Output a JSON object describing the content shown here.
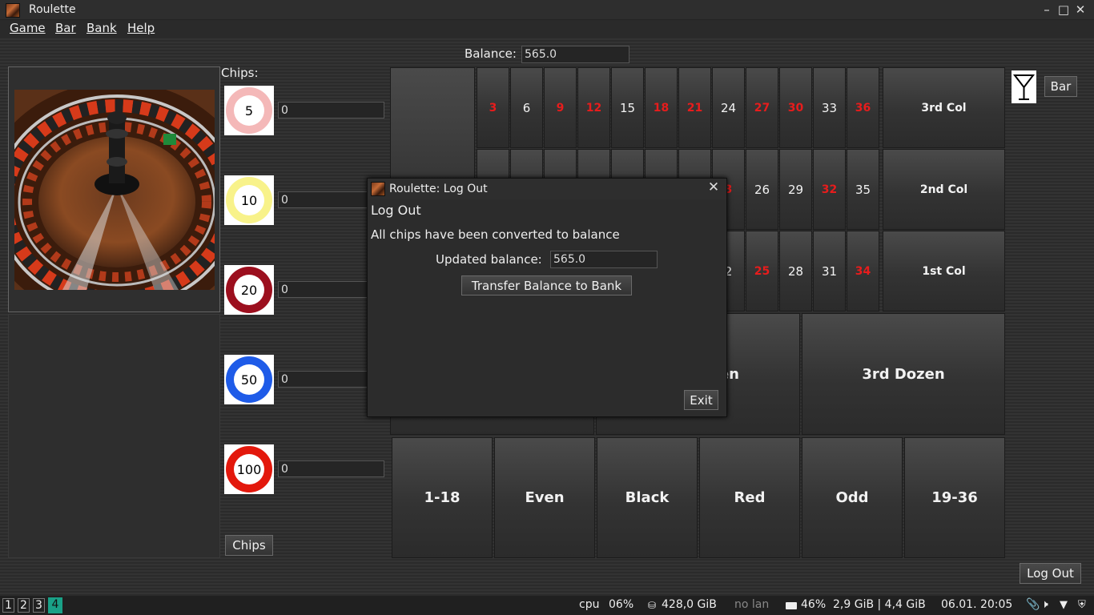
{
  "window": {
    "title": "Roulette"
  },
  "menu": [
    "Game",
    "Bar",
    "Bank",
    "Help"
  ],
  "balance": {
    "label": "Balance:",
    "value": "565.0"
  },
  "chips_panel": {
    "heading": "Chips:",
    "chips": [
      {
        "value": "5",
        "count": "0",
        "color": "#f4b8b8"
      },
      {
        "value": "10",
        "count": "0",
        "color": "#f8f28a"
      },
      {
        "value": "20",
        "count": "0",
        "color": "#9c0f1e"
      },
      {
        "value": "50",
        "count": "0",
        "color": "#1e5be8"
      },
      {
        "value": "100",
        "count": "0",
        "color": "#e3180c"
      }
    ],
    "button": "Chips"
  },
  "board": {
    "rows": [
      [
        {
          "n": "3",
          "c": "red"
        },
        {
          "n": "6",
          "c": "black"
        },
        {
          "n": "9",
          "c": "red"
        },
        {
          "n": "12",
          "c": "red"
        },
        {
          "n": "15",
          "c": "black"
        },
        {
          "n": "18",
          "c": "red"
        },
        {
          "n": "21",
          "c": "red"
        },
        {
          "n": "24",
          "c": "black"
        },
        {
          "n": "27",
          "c": "red"
        },
        {
          "n": "30",
          "c": "red"
        },
        {
          "n": "33",
          "c": "black"
        },
        {
          "n": "36",
          "c": "red"
        }
      ],
      [
        {
          "n": "",
          "c": "black"
        },
        {
          "n": "",
          "c": "black"
        },
        {
          "n": "",
          "c": "black"
        },
        {
          "n": "",
          "c": "black"
        },
        {
          "n": "",
          "c": "black"
        },
        {
          "n": "",
          "c": "black"
        },
        {
          "n": "",
          "c": "black"
        },
        {
          "n": "3",
          "c": "red"
        },
        {
          "n": "26",
          "c": "black"
        },
        {
          "n": "29",
          "c": "black"
        },
        {
          "n": "32",
          "c": "red"
        },
        {
          "n": "35",
          "c": "black"
        }
      ],
      [
        {
          "n": "",
          "c": "black"
        },
        {
          "n": "",
          "c": "black"
        },
        {
          "n": "",
          "c": "black"
        },
        {
          "n": "",
          "c": "black"
        },
        {
          "n": "",
          "c": "black"
        },
        {
          "n": "",
          "c": "black"
        },
        {
          "n": "",
          "c": "black"
        },
        {
          "n": "2",
          "c": "black"
        },
        {
          "n": "25",
          "c": "red"
        },
        {
          "n": "28",
          "c": "black"
        },
        {
          "n": "31",
          "c": "black"
        },
        {
          "n": "34",
          "c": "red"
        }
      ]
    ],
    "columns": [
      "3rd Col",
      "2nd Col",
      "1st Col"
    ],
    "dozens": [
      "",
      "en",
      "3rd Dozen"
    ],
    "outside": [
      "1-18",
      "Even",
      "Black",
      "Red",
      "Odd",
      "19-36"
    ]
  },
  "bar_button": "Bar",
  "logout_button": "Log Out",
  "dialog": {
    "title": "Roulette: Log Out",
    "heading": "Log Out",
    "message": "All chips have been converted to balance",
    "updated_label": "Updated balance:",
    "updated_value": "565.0",
    "transfer_button": "Transfer Balance to Bank",
    "exit_button": "Exit"
  },
  "taskbar": {
    "workspaces": [
      "1",
      "2",
      "3",
      "4"
    ],
    "active_workspace": "4",
    "cpu_label": "cpu",
    "cpu_value": "06%",
    "disk": "428,0 GiB",
    "network": "no lan",
    "battery": "46%",
    "memory": "2,9 GiB | 4,4 GiB",
    "datetime": "06.01. 20:05"
  }
}
